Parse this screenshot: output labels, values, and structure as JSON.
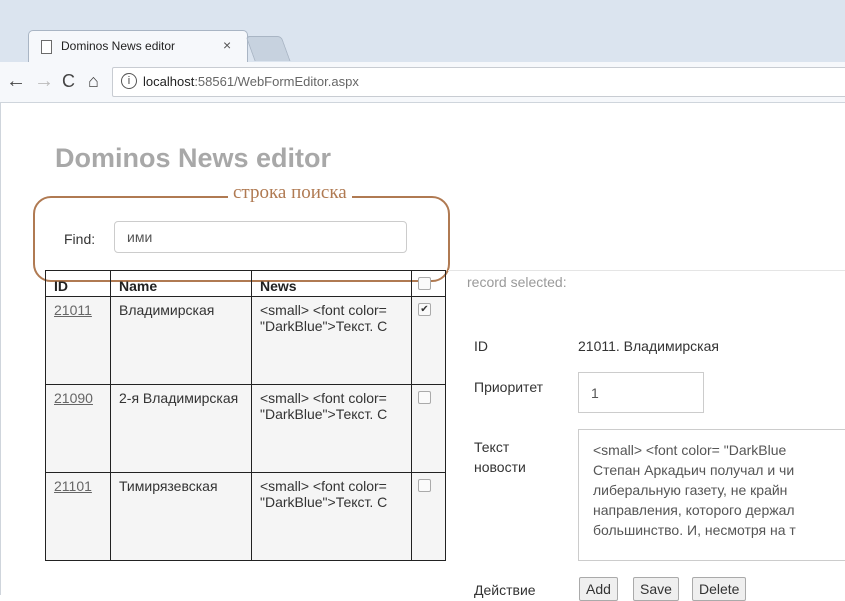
{
  "browser": {
    "tab_title": "Dominos News editor",
    "tab_close": "×",
    "url_host": "localhost",
    "url_rest": ":58561/WebFormEditor.aspx",
    "nav": {
      "back": "←",
      "forward": "→",
      "reload": "C",
      "home": "⌂",
      "info": "i"
    }
  },
  "page": {
    "title": "Dominos News editor",
    "search_caption": "строка поиска",
    "find_label": "Find:",
    "find_value": "ими"
  },
  "table": {
    "headers": [
      "ID",
      "Name",
      "News"
    ],
    "rows": [
      {
        "id": "21011",
        "name": "Владимирская",
        "news": "<small> <font color= \"DarkBlue\">Текст. С",
        "checked": true
      },
      {
        "id": "21090",
        "name": "2-я Владимирская",
        "news": "<small> <font color= \"DarkBlue\">Текст. С",
        "checked": false
      },
      {
        "id": "21101",
        "name": "Тимирязевская",
        "news": "<small> <font color= \"DarkBlue\">Текст. С",
        "checked": false
      }
    ]
  },
  "details": {
    "record_selected": "record selected:",
    "id_label": "ID",
    "id_value": "21011. Владимирская",
    "priority_label": "Приоритет",
    "priority_value": "1",
    "text_label": "Текст новости",
    "text_value": "<small> <font color= \"DarkBlue\nСтепан Аркадьич получал и чи\nлиберальную газету, не крайн\nнаправления, которого держал\nбольшинство. И, несмотря на т",
    "action_label": "Действие",
    "buttons": {
      "add": "Add",
      "save": "Save",
      "delete": "Delete"
    }
  }
}
